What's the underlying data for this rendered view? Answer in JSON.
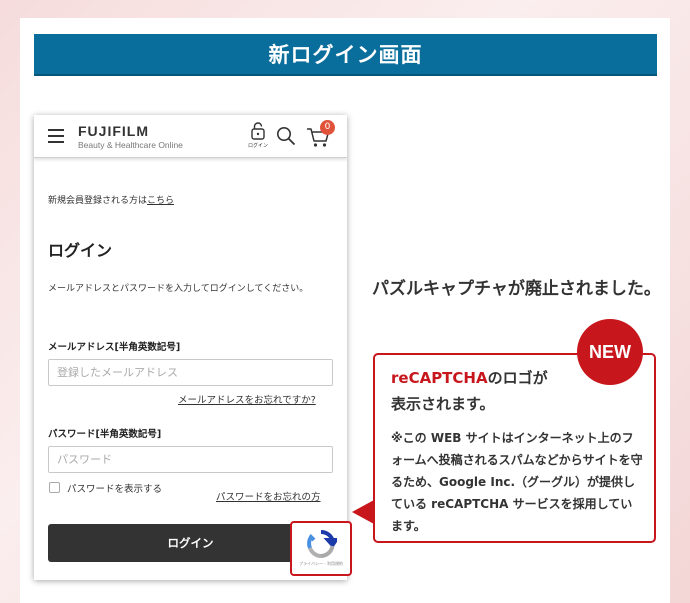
{
  "header": {
    "title": "新ログイン画面"
  },
  "phone": {
    "brand": "FUJIFILM",
    "brand_sub": "Beauty & Healthcare Online",
    "login_icon_label": "ログイン",
    "cart_count": "0",
    "register_text": "新規会員登録される方は",
    "register_link": "こちら",
    "login_heading": "ログイン",
    "instructions": "メールアドレスとパスワードを入力してログインしてください。",
    "email_label": "メールアドレス[半角英数記号]",
    "email_placeholder": "登録したメールアドレス",
    "forgot_email": "メールアドレスをお忘れですか?",
    "password_label": "パスワード[半角英数記号]",
    "password_placeholder": "パスワード",
    "show_password": "パスワードを表示する",
    "forgot_password": "パスワードをお忘れの方",
    "login_button": "ログイン",
    "recaptcha_privacy": "プライバシー - 利用規約"
  },
  "announcement": "パズルキャプチャが廃止されました。",
  "callout": {
    "badge": "NEW",
    "heading_accent": "reCAPTCHA",
    "heading_rest_1": "のロゴが",
    "heading_rest_2": "表示されます。",
    "body": "※この WEB サイトはインターネット上のフォームへ投稿されるスパムなどからサイトを守るため、Google Inc.（グーグル）が提供している reCAPTCHA サービスを採用しています。"
  },
  "colors": {
    "title_bar": "#0a6e9c",
    "accent_red": "#c8161d",
    "button_dark": "#333333"
  }
}
